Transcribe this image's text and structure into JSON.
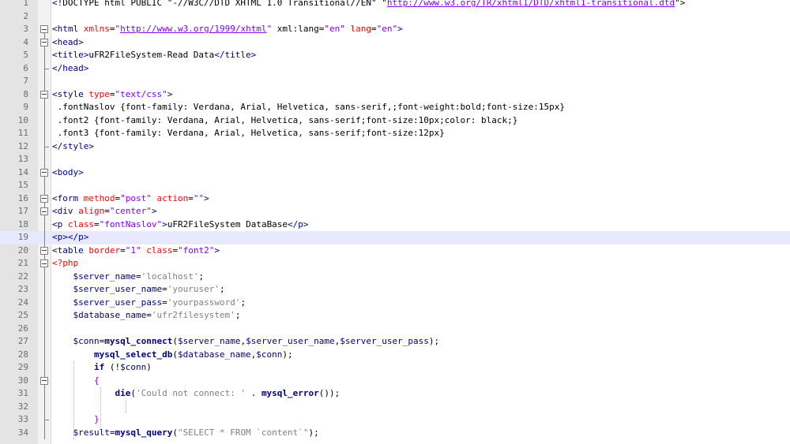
{
  "editor": {
    "language": "PHP / HTML",
    "current_line": 19
  },
  "lines": [
    {
      "n": "1",
      "fold": "none",
      "segs": [
        {
          "c": "t-tag",
          "t": "<!"
        },
        {
          "c": "",
          "t": "DOCTYPE html PUBLIC \"-//W3C//DTD XHTML 1.0 Transitional//EN\" \""
        },
        {
          "c": "t-url",
          "t": "http://www.w3.org/TR/xhtml1/DTD/xhtml1-transitional.dtd"
        },
        {
          "c": "",
          "t": "\">"
        }
      ]
    },
    {
      "n": "2",
      "fold": "none",
      "segs": []
    },
    {
      "n": "3",
      "fold": "open",
      "segs": [
        {
          "c": "t-tag",
          "t": "<html "
        },
        {
          "c": "t-attr",
          "t": "xmlns"
        },
        {
          "c": "",
          "t": "="
        },
        {
          "c": "t-str",
          "t": "\""
        },
        {
          "c": "t-url",
          "t": "http://www.w3.org/1999/xhtml"
        },
        {
          "c": "t-str",
          "t": "\""
        },
        {
          "c": "",
          "t": " xml:lang="
        },
        {
          "c": "t-str",
          "t": "\"en\""
        },
        {
          "c": "t-attr",
          "t": " lang"
        },
        {
          "c": "",
          "t": "="
        },
        {
          "c": "t-str",
          "t": "\"en\""
        },
        {
          "c": "t-tag",
          "t": ">"
        }
      ]
    },
    {
      "n": "4",
      "fold": "open",
      "segs": [
        {
          "c": "t-tag",
          "t": "<head>"
        }
      ]
    },
    {
      "n": "5",
      "fold": "line",
      "segs": [
        {
          "c": "t-tag",
          "t": "<title>"
        },
        {
          "c": "",
          "t": "uFR2FileSystem-Read Data"
        },
        {
          "c": "t-tag",
          "t": "</title>"
        }
      ]
    },
    {
      "n": "6",
      "fold": "end",
      "segs": [
        {
          "c": "t-tag",
          "t": "</head>"
        }
      ]
    },
    {
      "n": "7",
      "fold": "line",
      "segs": []
    },
    {
      "n": "8",
      "fold": "open",
      "segs": [
        {
          "c": "t-tag",
          "t": "<style "
        },
        {
          "c": "t-attr",
          "t": "type"
        },
        {
          "c": "",
          "t": "="
        },
        {
          "c": "t-str",
          "t": "\"text/css\""
        },
        {
          "c": "t-tag",
          "t": ">"
        }
      ]
    },
    {
      "n": "9",
      "fold": "line",
      "segs": [
        {
          "c": "",
          "t": " .fontNaslov {font-family: Verdana, Arial, Helvetica, sans-serif,;font-weight:bold;font-size:15px}"
        }
      ]
    },
    {
      "n": "10",
      "fold": "line",
      "segs": [
        {
          "c": "",
          "t": " .font2 {font-family: Verdana, Arial, Helvetica, sans-serif;font-size:10px;color: black;}"
        }
      ]
    },
    {
      "n": "11",
      "fold": "line",
      "segs": [
        {
          "c": "",
          "t": " .font3 {font-family: Verdana, Arial, Helvetica, sans-serif;font-size:12px}"
        }
      ]
    },
    {
      "n": "12",
      "fold": "end",
      "segs": [
        {
          "c": "t-tag",
          "t": "</style>"
        }
      ]
    },
    {
      "n": "13",
      "fold": "line",
      "segs": []
    },
    {
      "n": "14",
      "fold": "open",
      "segs": [
        {
          "c": "t-tag",
          "t": "<body>"
        }
      ]
    },
    {
      "n": "15",
      "fold": "line",
      "segs": []
    },
    {
      "n": "16",
      "fold": "open",
      "segs": [
        {
          "c": "t-tag",
          "t": "<form "
        },
        {
          "c": "t-attr",
          "t": "method"
        },
        {
          "c": "",
          "t": "="
        },
        {
          "c": "t-str",
          "t": "\"post\""
        },
        {
          "c": "t-attr",
          "t": " action"
        },
        {
          "c": "",
          "t": "="
        },
        {
          "c": "t-str",
          "t": "\"\""
        },
        {
          "c": "t-tag",
          "t": ">"
        }
      ]
    },
    {
      "n": "17",
      "fold": "open",
      "segs": [
        {
          "c": "t-tag",
          "t": "<div "
        },
        {
          "c": "t-attr",
          "t": "align"
        },
        {
          "c": "",
          "t": "="
        },
        {
          "c": "t-str",
          "t": "\"center\""
        },
        {
          "c": "t-tag",
          "t": ">"
        }
      ]
    },
    {
      "n": "18",
      "fold": "line",
      "segs": [
        {
          "c": "t-tag",
          "t": "<p "
        },
        {
          "c": "t-attr",
          "t": "class"
        },
        {
          "c": "",
          "t": "="
        },
        {
          "c": "t-str",
          "t": "\"fontNaslov\""
        },
        {
          "c": "t-tag",
          "t": ">"
        },
        {
          "c": "",
          "t": "uFR2FileSystem DataBase"
        },
        {
          "c": "t-tag",
          "t": "</p>"
        }
      ]
    },
    {
      "n": "19",
      "fold": "line",
      "segs": [
        {
          "c": "t-tag",
          "t": "<p></p>"
        }
      ]
    },
    {
      "n": "20",
      "fold": "open",
      "segs": [
        {
          "c": "t-tag",
          "t": "<table "
        },
        {
          "c": "t-attr",
          "t": "border"
        },
        {
          "c": "",
          "t": "="
        },
        {
          "c": "t-str",
          "t": "\"1\""
        },
        {
          "c": "t-attr",
          "t": " class"
        },
        {
          "c": "",
          "t": "="
        },
        {
          "c": "t-str",
          "t": "\"font2\""
        },
        {
          "c": "t-tag",
          "t": ">"
        }
      ]
    },
    {
      "n": "21",
      "fold": "open",
      "segs": [
        {
          "c": "t-php",
          "t": "<?php"
        }
      ]
    },
    {
      "n": "22",
      "fold": "line",
      "segs": [
        {
          "c": "",
          "t": "    "
        },
        {
          "c": "t-phpvar",
          "t": "$server_name"
        },
        {
          "c": "",
          "t": "="
        },
        {
          "c": "t-phpstr",
          "t": "'localhost'"
        },
        {
          "c": "",
          "t": ";"
        }
      ]
    },
    {
      "n": "23",
      "fold": "line",
      "segs": [
        {
          "c": "",
          "t": "    "
        },
        {
          "c": "t-phpvar",
          "t": "$server_user_name"
        },
        {
          "c": "",
          "t": "="
        },
        {
          "c": "t-phpstr",
          "t": "'youruser'"
        },
        {
          "c": "",
          "t": ";"
        }
      ]
    },
    {
      "n": "24",
      "fold": "line",
      "segs": [
        {
          "c": "",
          "t": "    "
        },
        {
          "c": "t-phpvar",
          "t": "$server_user_pass"
        },
        {
          "c": "",
          "t": "="
        },
        {
          "c": "t-phpstr",
          "t": "'yourpassword'"
        },
        {
          "c": "",
          "t": ";"
        }
      ]
    },
    {
      "n": "25",
      "fold": "line",
      "segs": [
        {
          "c": "",
          "t": "    "
        },
        {
          "c": "t-phpvar",
          "t": "$database_name"
        },
        {
          "c": "",
          "t": "="
        },
        {
          "c": "t-phpstr",
          "t": "'ufr2filesystem'"
        },
        {
          "c": "",
          "t": ";"
        }
      ]
    },
    {
      "n": "26",
      "fold": "line",
      "segs": []
    },
    {
      "n": "27",
      "fold": "line",
      "segs": [
        {
          "c": "",
          "t": "    "
        },
        {
          "c": "t-phpvar",
          "t": "$conn"
        },
        {
          "c": "",
          "t": "="
        },
        {
          "c": "t-fn",
          "t": "mysql_connect"
        },
        {
          "c": "",
          "t": "("
        },
        {
          "c": "t-phpvar",
          "t": "$server_name"
        },
        {
          "c": "",
          "t": ","
        },
        {
          "c": "t-phpvar",
          "t": "$server_user_name"
        },
        {
          "c": "",
          "t": ","
        },
        {
          "c": "t-phpvar",
          "t": "$server_user_pass"
        },
        {
          "c": "",
          "t": ");"
        }
      ]
    },
    {
      "n": "28",
      "fold": "line",
      "segs": [
        {
          "c": "",
          "t": "        "
        },
        {
          "c": "t-fn",
          "t": "mysql_select_db"
        },
        {
          "c": "",
          "t": "("
        },
        {
          "c": "t-phpvar",
          "t": "$database_name"
        },
        {
          "c": "",
          "t": ","
        },
        {
          "c": "t-phpvar",
          "t": "$conn"
        },
        {
          "c": "",
          "t": ");"
        }
      ]
    },
    {
      "n": "29",
      "fold": "line",
      "segs": [
        {
          "c": "",
          "t": "        "
        },
        {
          "c": "t-kw",
          "t": "if"
        },
        {
          "c": "",
          "t": " (!"
        },
        {
          "c": "t-phpvar",
          "t": "$conn"
        },
        {
          "c": "",
          "t": ")"
        }
      ]
    },
    {
      "n": "30",
      "fold": "open",
      "segs": [
        {
          "c": "",
          "t": "        "
        },
        {
          "c": "t-punct",
          "t": "{"
        }
      ]
    },
    {
      "n": "31",
      "fold": "line",
      "segs": [
        {
          "c": "",
          "t": "            "
        },
        {
          "c": "t-fn",
          "t": "die"
        },
        {
          "c": "",
          "t": "("
        },
        {
          "c": "t-phpstr",
          "t": "'Could not connect: '"
        },
        {
          "c": "",
          "t": " . "
        },
        {
          "c": "t-fn",
          "t": "mysql_error"
        },
        {
          "c": "",
          "t": "());"
        }
      ]
    },
    {
      "n": "32",
      "fold": "line",
      "segs": []
    },
    {
      "n": "33",
      "fold": "end",
      "segs": [
        {
          "c": "",
          "t": "        "
        },
        {
          "c": "t-punct",
          "t": "}"
        }
      ]
    },
    {
      "n": "34",
      "fold": "line",
      "segs": [
        {
          "c": "",
          "t": "    "
        },
        {
          "c": "t-phpvar",
          "t": "$result"
        },
        {
          "c": "",
          "t": "="
        },
        {
          "c": "t-fn",
          "t": "mysql_query"
        },
        {
          "c": "",
          "t": "("
        },
        {
          "c": "t-phpstr",
          "t": "\"SELECT * FROM `content`\""
        },
        {
          "c": "",
          "t": ");"
        }
      ]
    }
  ]
}
